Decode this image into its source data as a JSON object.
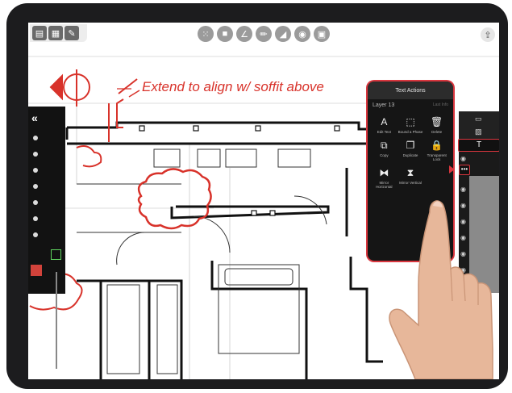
{
  "annotation": {
    "text": "Extend to align w/ soffit above",
    "color": "#d8322a"
  },
  "toolbar": {
    "left_tools": [
      "layers-icon",
      "grid-icon",
      "wrench-icon"
    ],
    "center_tools": [
      "grid-dots-icon",
      "square-icon",
      "angle-icon",
      "pencil-icon",
      "ruler-icon",
      "record-icon",
      "frame-icon"
    ],
    "share_icon": "share-icon"
  },
  "text_actions_popup": {
    "title": "Text Actions",
    "layer": "Layer 13",
    "info": "Last Info",
    "actions": [
      {
        "label": "Edit Text",
        "icon": "text-edit-icon"
      },
      {
        "label": "Bound a Phase",
        "icon": "bound-icon"
      },
      {
        "label": "Delete",
        "icon": "trash-icon"
      },
      {
        "label": "Copy",
        "icon": "copy-icon"
      },
      {
        "label": "Duplicate",
        "icon": "duplicate-icon"
      },
      {
        "label": "Transparent Lock",
        "icon": "lock-icon"
      },
      {
        "label": "Mirror Horizontal",
        "icon": "mirror-horizontal-icon"
      },
      {
        "label": "Mirror Vertical",
        "icon": "mirror-vertical-icon"
      }
    ]
  },
  "right_panel": {
    "text_tool_label": "T",
    "more_label": "•••"
  },
  "colors": {
    "accent": "#d9363e",
    "device": "#1c1c1e",
    "panel": "#151515"
  }
}
